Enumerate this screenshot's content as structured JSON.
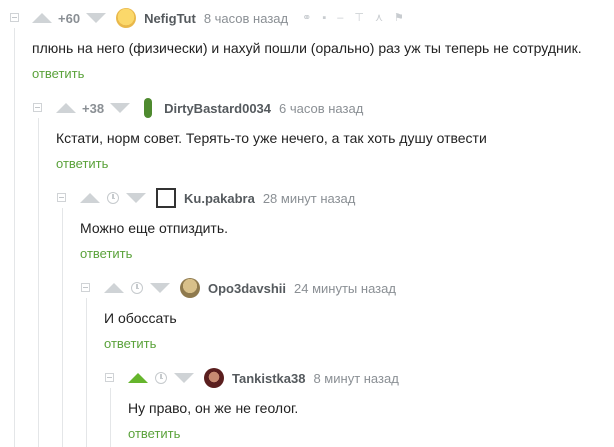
{
  "colors": {
    "reply_link": "#5aa23a",
    "vote_active": "#65b52c",
    "vote_inactive": "#cfd3d6",
    "thread_line": "#e4e6e8"
  },
  "comments": [
    {
      "rating": "+60",
      "username": "NefigTut",
      "timestamp": "8 часов назад",
      "text": "плюнь на него (физически) и нахуй пошли (орально) раз уж ты теперь не сотрудник.",
      "reply_label": "ответить",
      "avatar_icon": "smiling-face-avatar",
      "actions": [
        "link-icon",
        "save-icon",
        "minus-icon",
        "pin-up-icon",
        "branch-icon",
        "flag-icon"
      ]
    },
    {
      "rating": "+38",
      "username": "DirtyBastard0034",
      "timestamp": "6 часов назад",
      "text": "Кстати, норм совет. Терять-то уже нечего, а так хоть душу отвести",
      "reply_label": "ответить",
      "avatar_icon": "pickle-avatar"
    },
    {
      "username": "Ku.pakabra",
      "timestamp": "28 минут назад",
      "text": "Можно еще отпиздить.",
      "reply_label": "ответить",
      "avatar_icon": "band-logo-avatar"
    },
    {
      "username": "Opo3davshii",
      "timestamp": "24 минуты назад",
      "text": "И обоссать",
      "reply_label": "ответить",
      "avatar_icon": "dog-avatar"
    },
    {
      "username": "Tankistka38",
      "timestamp": "8 минут назад",
      "text": "Ну право, он же не геолог.",
      "reply_label": "ответить",
      "avatar_icon": "photo-avatar",
      "upvoted": true
    }
  ]
}
